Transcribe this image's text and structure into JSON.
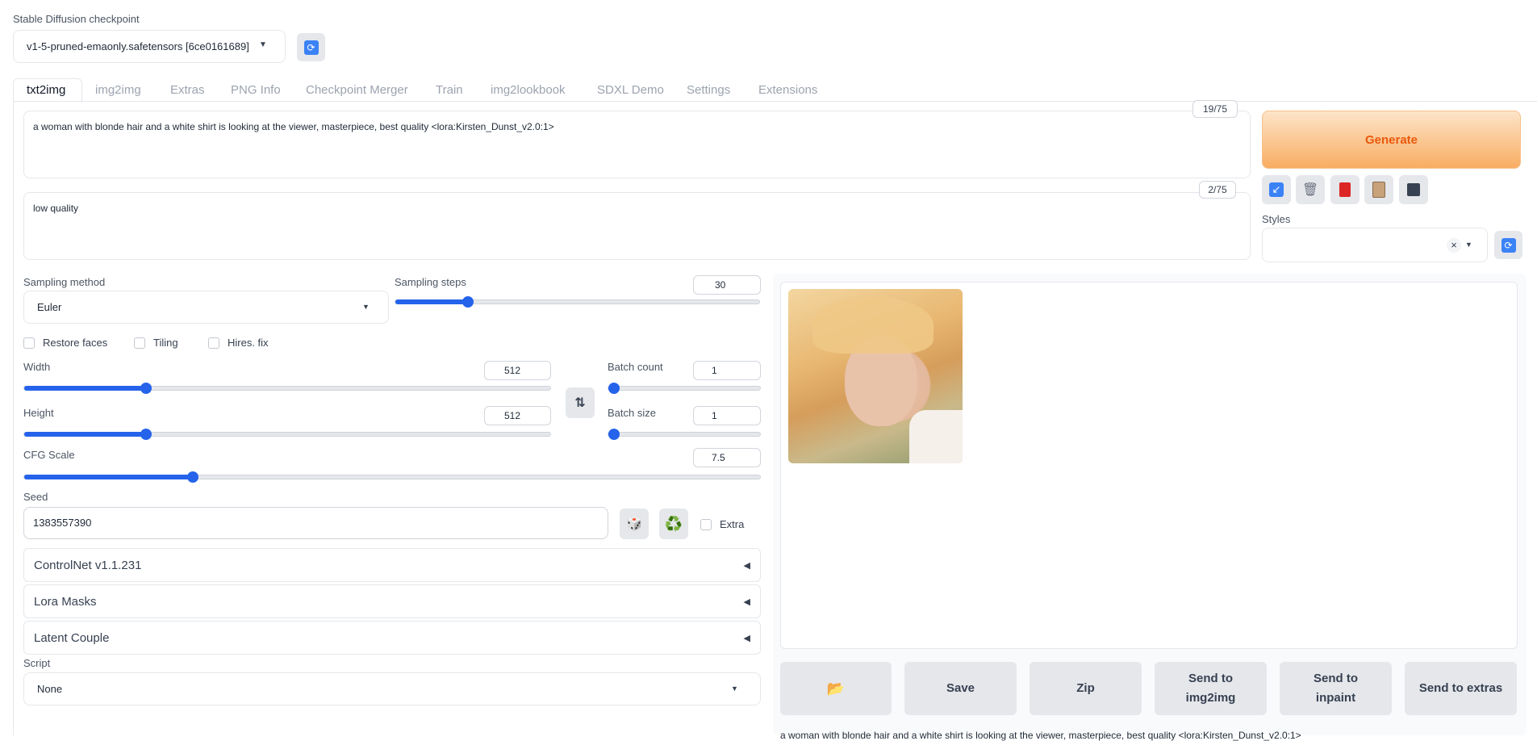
{
  "checkpoint": {
    "label": "Stable Diffusion checkpoint",
    "value": "v1-5-pruned-emaonly.safetensors [6ce0161689]",
    "refresh_icon": "refresh-icon"
  },
  "tabs": [
    "txt2img",
    "img2img",
    "Extras",
    "PNG Info",
    "Checkpoint Merger",
    "Train",
    "img2lookbook",
    "SDXL Demo",
    "Settings",
    "Extensions"
  ],
  "prompt": {
    "positive": "a woman with blonde hair and a white shirt is looking at the viewer, masterpiece, best quality  <lora:Kirsten_Dunst_v2.0:1>",
    "positive_counter": "19/75",
    "negative": "low quality",
    "negative_counter": "2/75"
  },
  "generate": {
    "label": "Generate",
    "icons": [
      "arrow-icon",
      "trash-icon",
      "card-icon",
      "clipboard-icon",
      "save-icon"
    ]
  },
  "styles": {
    "label": "Styles",
    "clear": "×"
  },
  "sampling": {
    "method_label": "Sampling method",
    "method_value": "Euler",
    "steps_label": "Sampling steps",
    "steps_value": "30",
    "steps_frac": 0.2
  },
  "checkboxes": {
    "restore_faces": "Restore faces",
    "tiling": "Tiling",
    "hires": "Hires. fix",
    "extra": "Extra"
  },
  "dimensions": {
    "width_label": "Width",
    "width_value": "512",
    "width_frac": 0.231,
    "height_label": "Height",
    "height_value": "512",
    "height_frac": 0.231,
    "swap_icon": "⇅"
  },
  "batch": {
    "count_label": "Batch count",
    "count_value": "1",
    "count_frac": 0.0,
    "size_label": "Batch size",
    "size_value": "1",
    "size_frac": 0.0
  },
  "cfg": {
    "label": "CFG Scale",
    "value": "7.5",
    "frac": 0.229
  },
  "seed": {
    "label": "Seed",
    "value": "1383557390",
    "dice_icon": "🎲",
    "recycle_icon": "♻️"
  },
  "accordions": [
    "ControlNet v1.1.231",
    "Lora Masks",
    "Latent Couple"
  ],
  "accordion_arrow": "◀",
  "script": {
    "label": "Script",
    "value": "None"
  },
  "output": {
    "buttons": [
      "Save",
      "Zip",
      "Send to img2img",
      "Send to inpaint",
      "Send to extras"
    ],
    "folder_icon": "📂",
    "caption": "a woman with blonde hair and a white shirt is looking at the viewer, masterpiece, best quality <lora:Kirsten_Dunst_v2.0:1>"
  },
  "colors": {
    "accent": "#2563eb",
    "generate_text": "#ea580c",
    "generate_bg_top": "#fdd9b5",
    "generate_bg_bottom": "#f9a54e"
  }
}
